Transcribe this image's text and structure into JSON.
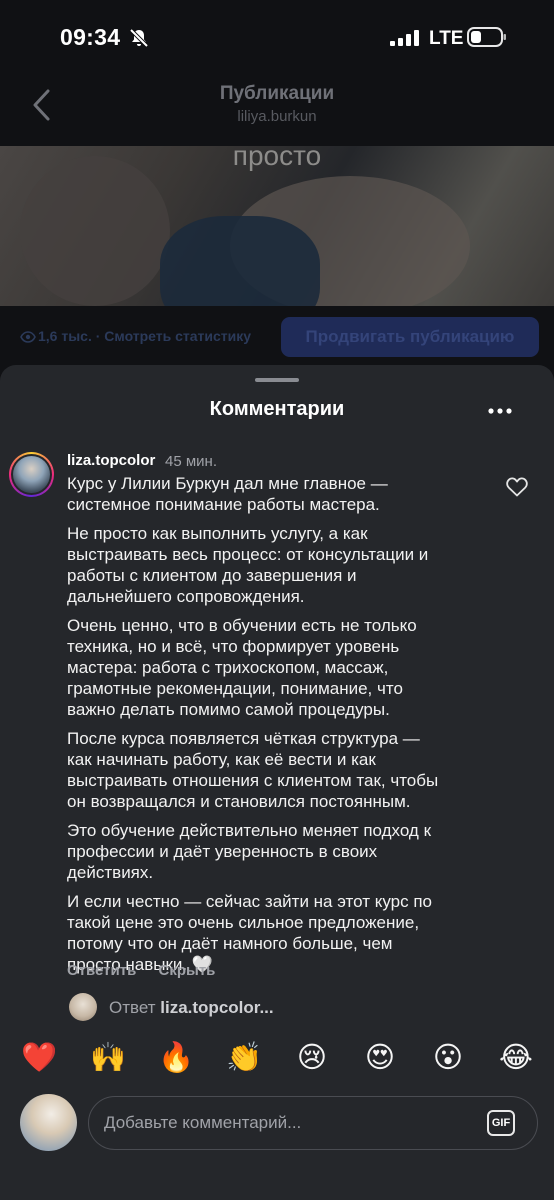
{
  "status_bar": {
    "time": "09:34",
    "network": "LTE"
  },
  "nav": {
    "title": "Публикации",
    "subtitle": "liliya.burkun"
  },
  "video": {
    "caption": "просто"
  },
  "stats": {
    "views": "1,6 тыс. · Смотреть статистику",
    "promote_label": "Продвигать публикацию"
  },
  "sheet": {
    "title": "Комментарии"
  },
  "comment": {
    "username": "liza.topcolor",
    "time": "45 мин.",
    "paragraphs": [
      "Курс у Лилии Буркун дал мне главное —\nсистемное понимание работы мастера.",
      "Не просто как выполнить услугу, а как\nвыстраивать весь процесс: от консультации и\nработы с клиентом до завершения и\nдальнейшего сопровождения.",
      "Очень ценно, что в обучении есть не только\nтехника, но и всё, что формирует уровень\nмастера: работа с трихоскопом, массаж,\nграмотные рекомендации, понимание, что\nважно делать помимо самой процедуры.",
      "После курса появляется чёткая структура —\nкак начинать работу, как её вести и как\nвыстраивать отношения с клиентом так, чтобы\nон возвращался и становился постоянным.",
      "Это обучение действительно меняет подход к\nпрофессии и даёт уверенность в своих\nдействиях.",
      "И если честно — сейчас зайти на этот курс по\nтакой цене это очень сильное предложение,\nпотому что он даёт намного больше, чем\nпросто навыки. 🤍"
    ],
    "reply_label": "Ответить",
    "hide_label": "Скрыть"
  },
  "reply_to": {
    "prefix": "Ответ",
    "username": "liza.topcolor..."
  },
  "emojis": [
    "❤️",
    "🙌",
    "🔥",
    "👏",
    "😢",
    "😍",
    "😮",
    "😂"
  ],
  "input": {
    "placeholder": "Добавьте комментарий...",
    "gif_label": "GIF"
  },
  "colors": {
    "sheet_bg": "#25272b",
    "accent_button": "#1f2b58",
    "heart": "#ff3040"
  }
}
